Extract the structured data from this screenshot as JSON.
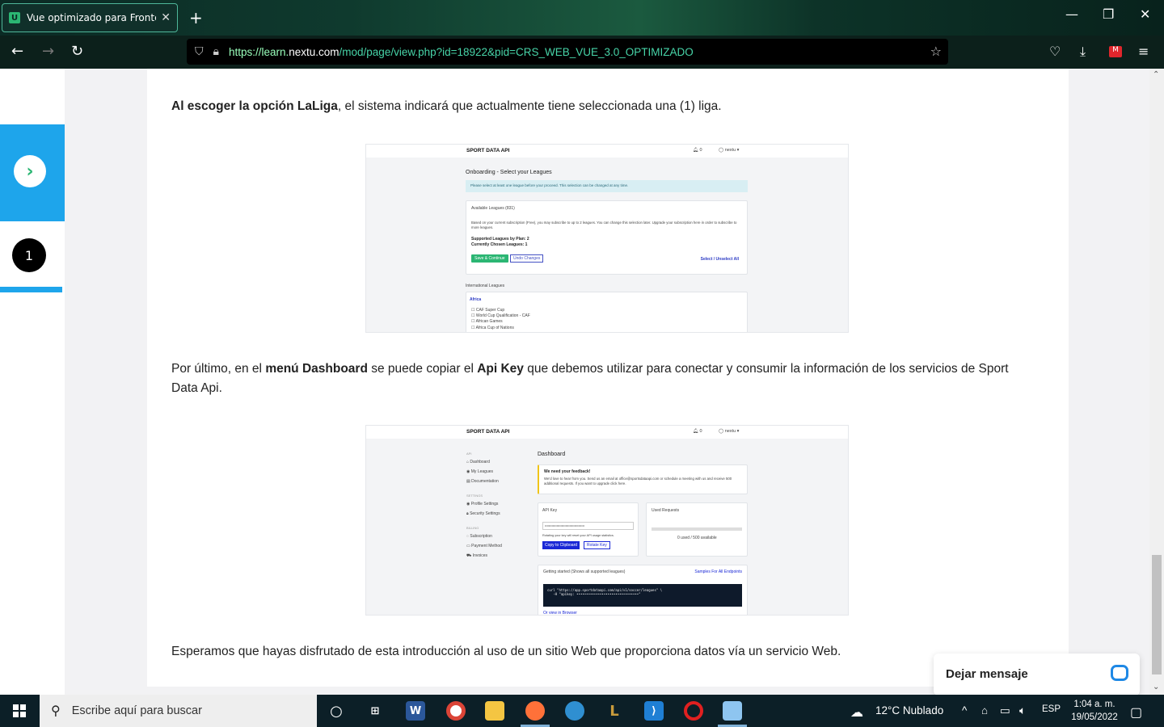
{
  "browser": {
    "tab_title": "Vue optimizado para Frontend",
    "tab_favicon": "U",
    "url_prefix": "https://learn.",
    "url_domain": "nextu.com",
    "url_path": "/mod/page/view.php?id=18922&pid=CRS_WEB_VUE_3.0_OPTIMIZADO"
  },
  "sidebar": {
    "step_number": "1"
  },
  "content": {
    "para1": {
      "bold": "Al escoger la opción LaLiga",
      "rest": ", el sistema indicará que actualmente tiene seleccionada una (1) liga."
    },
    "para2": {
      "t1": "Por último, en el ",
      "b1": "menú Dashboard",
      "t2": " se puede copiar el ",
      "b2": "Api Key",
      "t3": " que debemos utilizar para conectar y consumir la información de los servicios de Sport Data Api."
    },
    "para3": "Esperamos que hayas disfrutado de esta introducción al uso de un sitio Web que proporciona datos vía un servicio Web."
  },
  "shot1": {
    "brand": "SPORT DATA API",
    "bell": "0",
    "user": "nextu",
    "title": "Onboarding - Select your Leagues",
    "alert": "Please select at least one league before your proceed. This selection can be changed at any time.",
    "card_title": "Available Leagues (831)",
    "card_text": "Based on your current subscription (Free), you may subscribe to up to 2 leagues. You can change this selection later. Upgrade your subscription here in order to subscribe to more leagues.",
    "supported": "Supported Leagues by Plan: 2",
    "chosen": "Currently Chosen Leagues: 1",
    "save_btn": "Save & Continue",
    "undo_btn": "Undo Changes",
    "select_all": "Select / Unselect All",
    "intl": "International Leagues",
    "region": "Africa",
    "leagues": [
      "CAF Super Cup",
      "World Cup Qualification - CAF",
      "African Games",
      "Africa Cup of Nations"
    ]
  },
  "shot2": {
    "brand": "SPORT DATA API",
    "bell": "0",
    "user": "nextu",
    "section_api": "API",
    "nav": [
      "Dashboard",
      "My Leagues",
      "Documentation"
    ],
    "section_settings": "SETTINGS",
    "nav_settings": [
      "Profile Settings",
      "Security Settings"
    ],
    "section_billing": "BILLING",
    "nav_billing": [
      "Subscription",
      "Payment Method",
      "Invoices"
    ],
    "title": "Dashboard",
    "feedback_title": "We need your feedback!",
    "feedback_text": "We'd love to hear from you. Send us an email at office@sportsdataapi.com or schedule a meeting with us and receive 500 additional requests. If you want to upgrade click here.",
    "apikey_title": "API Key",
    "apikey_value": "••••••••••••••••••••••••••••••••••••••••",
    "apikey_note": "Rotating your key will reset your API usage statistics.",
    "copy_btn": "Copy to Clipboard",
    "rotate_btn": "Rotate Key",
    "used_title": "Used Requests",
    "used_value": "0 used / 500 available",
    "getting_started": "Getting started (Shows all supported leagues)",
    "samples_link": "Samples For All Endpoints",
    "code": "curl \"https://app.sportdataapi.com/api/v1/soccer/leagues\" \\\n   -H \"apikey: ••••••••••••••••••••••••••••••••\"",
    "view_browser": "Or view in Browser"
  },
  "chat": {
    "label": "Dejar mensaje"
  },
  "taskbar": {
    "search_placeholder": "Escribe aquí para buscar",
    "weather": "12°C  Nublado",
    "lang": "ESP",
    "time": "1:04 a. m.",
    "date": "19/05/2022"
  },
  "colors": {
    "accent_blue": "#1ea5eb",
    "url_green": "#47d4a8",
    "chat_blue": "#1e88e5"
  }
}
